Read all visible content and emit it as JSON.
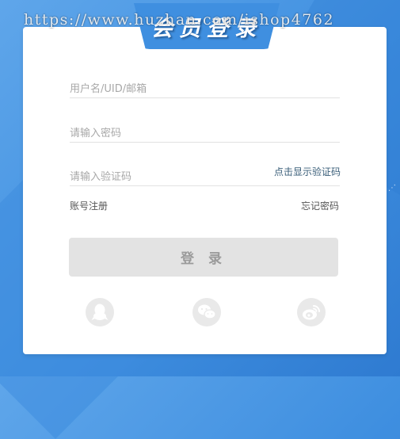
{
  "watermark": "https://www.huzhan.com/ishop4762",
  "header": {
    "title": "会员登录"
  },
  "form": {
    "username_placeholder": "用户名/UID/邮箱",
    "password_placeholder": "请输入密码",
    "captcha_placeholder": "请输入验证码",
    "captcha_link": "点击显示验证码",
    "register_link": "账号注册",
    "forgot_link": "忘记密码",
    "login_label": "登 录"
  },
  "social": [
    {
      "name": "qq-icon"
    },
    {
      "name": "wechat-icon"
    },
    {
      "name": "weibo-icon"
    }
  ],
  "colors": {
    "background": "#3f8fe0",
    "title_tab": "#3f8fe0",
    "button_disabled": "#e3e3e3",
    "social_bg": "#e9e9e9"
  }
}
